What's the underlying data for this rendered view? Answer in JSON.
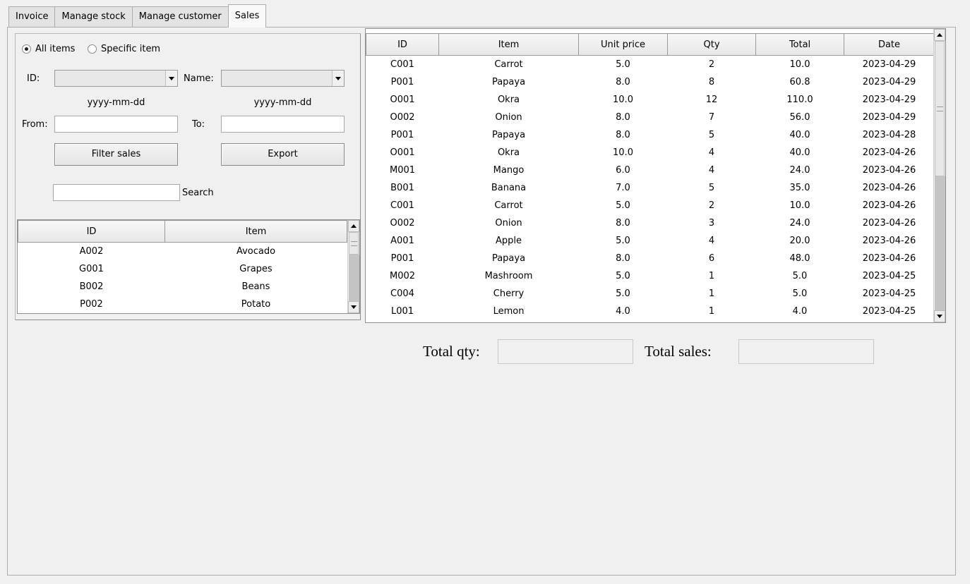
{
  "tabs": [
    {
      "label": "Invoice",
      "active": false
    },
    {
      "label": "Manage stock",
      "active": false
    },
    {
      "label": "Manage customer",
      "active": false
    },
    {
      "label": "Sales",
      "active": true
    }
  ],
  "filter": {
    "radio_all": "All items",
    "radio_specific": "Specific item",
    "selected_mode": "All items",
    "id_label": "ID:",
    "id_value": "",
    "name_label": "Name:",
    "name_value": "",
    "date_hint_from": "yyyy-mm-dd",
    "date_hint_to": "yyyy-mm-dd",
    "from_label": "From:",
    "from_value": "",
    "to_label": "To:",
    "to_value": "",
    "filter_button": "Filter sales",
    "export_button": "Export",
    "search_value": "",
    "search_label": "Search"
  },
  "items_table": {
    "columns": [
      "ID",
      "Item"
    ],
    "rows": [
      [
        "A002",
        "Avocado"
      ],
      [
        "G001",
        "Grapes"
      ],
      [
        "B002",
        "Beans"
      ],
      [
        "P002",
        "Potato"
      ]
    ]
  },
  "sales_table": {
    "columns": [
      "ID",
      "Item",
      "Unit price",
      "Qty",
      "Total",
      "Date"
    ],
    "rows": [
      [
        "C001",
        "Carrot",
        "5.0",
        "2",
        "10.0",
        "2023-04-29"
      ],
      [
        "P001",
        "Papaya",
        "8.0",
        "8",
        "60.8",
        "2023-04-29"
      ],
      [
        "O001",
        "Okra",
        "10.0",
        "12",
        "110.0",
        "2023-04-29"
      ],
      [
        "O002",
        "Onion",
        "8.0",
        "7",
        "56.0",
        "2023-04-29"
      ],
      [
        "P001",
        "Papaya",
        "8.0",
        "5",
        "40.0",
        "2023-04-28"
      ],
      [
        "O001",
        "Okra",
        "10.0",
        "4",
        "40.0",
        "2023-04-26"
      ],
      [
        "M001",
        "Mango",
        "6.0",
        "4",
        "24.0",
        "2023-04-26"
      ],
      [
        "B001",
        "Banana",
        "7.0",
        "5",
        "35.0",
        "2023-04-26"
      ],
      [
        "C001",
        "Carrot",
        "5.0",
        "2",
        "10.0",
        "2023-04-26"
      ],
      [
        "O002",
        "Onion",
        "8.0",
        "3",
        "24.0",
        "2023-04-26"
      ],
      [
        "A001",
        "Apple",
        "5.0",
        "4",
        "20.0",
        "2023-04-26"
      ],
      [
        "P001",
        "Papaya",
        "8.0",
        "6",
        "48.0",
        "2023-04-26"
      ],
      [
        "M002",
        "Mashroom",
        "5.0",
        "1",
        "5.0",
        "2023-04-25"
      ],
      [
        "C004",
        "Cherry",
        "5.0",
        "1",
        "5.0",
        "2023-04-25"
      ],
      [
        "L001",
        "Lemon",
        "4.0",
        "1",
        "4.0",
        "2023-04-25"
      ]
    ]
  },
  "totals": {
    "qty_label": "Total qty:",
    "qty_value": "",
    "sales_label": "Total sales:",
    "sales_value": ""
  }
}
